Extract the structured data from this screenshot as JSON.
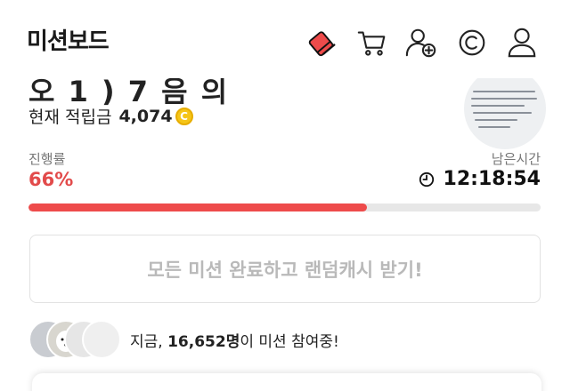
{
  "header": {
    "title": "미션보드",
    "icons": [
      "mission-shoe-icon",
      "cart-icon",
      "add-friend-icon",
      "cash-coin-icon",
      "profile-icon"
    ]
  },
  "summary": {
    "cut_heading": "오 1 ) 7 음 의",
    "points_label": "현재 적립금",
    "points_value": "4,074",
    "coin_glyph": "C"
  },
  "progress": {
    "label": "진행률",
    "percent_text": "66%",
    "percent": 66,
    "remaining_label": "남은시간",
    "remaining_time": "12:18:54",
    "bar_color": "#ee4b4b"
  },
  "cta": {
    "label": "모든 미션 완료하고 랜덤캐시 받기!"
  },
  "participants": {
    "prefix": "지금, ",
    "count": "16,652명",
    "suffix": "이 미션 참여중!"
  },
  "colors": {
    "accent": "#e24b4b",
    "coin": "#f5c518"
  }
}
